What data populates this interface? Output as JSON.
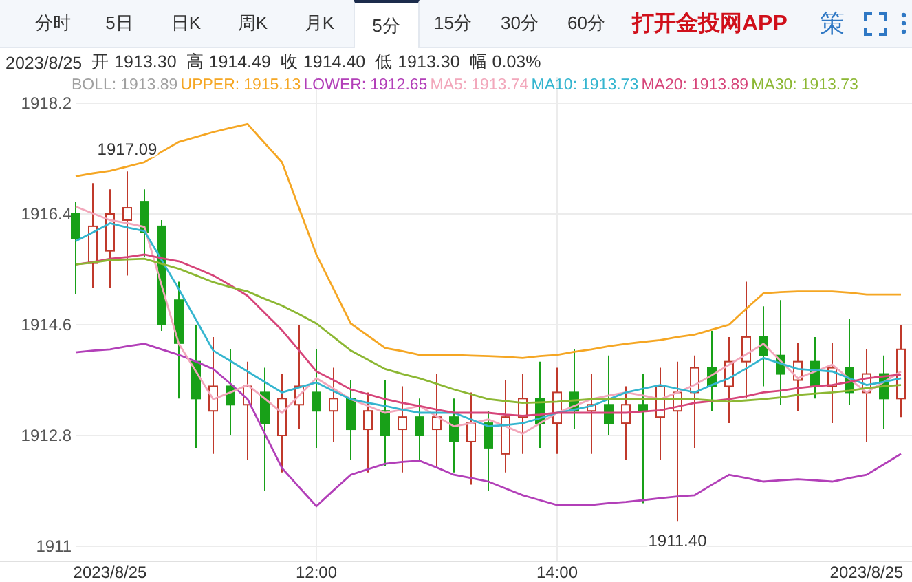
{
  "tabs": [
    {
      "label": "分时",
      "selected": false
    },
    {
      "label": "5日",
      "selected": false
    },
    {
      "label": "日K",
      "selected": false
    },
    {
      "label": "周K",
      "selected": false
    },
    {
      "label": "月K",
      "selected": false
    },
    {
      "label": "5分",
      "selected": true
    },
    {
      "label": "15分",
      "selected": false
    },
    {
      "label": "30分",
      "selected": false
    },
    {
      "label": "60分",
      "selected": false
    }
  ],
  "app_link": "打开金投网APP",
  "strategy_button": "策",
  "quote": {
    "date": "2023/8/25",
    "stats": [
      {
        "label": "开",
        "value": "1913.30"
      },
      {
        "label": "高",
        "value": "1914.49"
      },
      {
        "label": "收",
        "value": "1914.40"
      },
      {
        "label": "低",
        "value": "1913.30"
      },
      {
        "label": "幅",
        "value": "0.03%"
      }
    ]
  },
  "legend": [
    {
      "label": "BOLL:",
      "value": "1913.89",
      "color": "#a0a0a0"
    },
    {
      "value": "1915.13"
    },
    {
      "value": "1912.65"
    },
    {
      "value": "1913.74"
    },
    {
      "value": "1913.73"
    },
    {
      "value": "1913.89"
    },
    {
      "value": "1913.73"
    }
  ],
  "chart_data": {
    "type": "candlestick",
    "ylim": [
      1911,
      1918.2
    ],
    "yticks": [
      {
        "value": 1918.2,
        "label": "1918.2"
      },
      {
        "value": 1916.4,
        "label": "1916.4"
      },
      {
        "value": 1914.6,
        "label": "1914.6"
      },
      {
        "value": 1912.8,
        "label": "1912.8"
      },
      {
        "value": 1911,
        "label": "1911"
      }
    ],
    "grid": true,
    "categories": [
      null,
      null,
      "2023/8/25",
      null,
      null,
      null,
      null,
      null,
      null,
      null,
      null,
      null,
      null,
      null,
      "12:00",
      null,
      null,
      null,
      null,
      null,
      null,
      null,
      null,
      null,
      null,
      null,
      null,
      null,
      "14:00",
      null,
      null,
      null,
      null,
      null,
      null,
      null,
      null,
      null,
      null,
      null,
      null,
      null,
      null,
      null,
      null,
      null,
      "2023/8/25",
      null,
      null
    ],
    "ohlc": [
      [
        1916.4,
        1916.6,
        1915.1,
        1916.0
      ],
      [
        1915.6,
        1916.9,
        1915.2,
        1916.2
      ],
      [
        1915.8,
        1916.8,
        1915.2,
        1916.4
      ],
      [
        1916.3,
        1917.09,
        1915.4,
        1916.5
      ],
      [
        1916.6,
        1916.8,
        1915.7,
        1916.1
      ],
      [
        1916.2,
        1916.3,
        1914.5,
        1914.6
      ],
      [
        1915.0,
        1915.3,
        1913.4,
        1914.3
      ],
      [
        1914.0,
        1914.6,
        1912.6,
        1913.4
      ],
      [
        1913.2,
        1914.4,
        1912.5,
        1913.6
      ],
      [
        1913.6,
        1914.2,
        1912.8,
        1913.3
      ],
      [
        1913.3,
        1914.0,
        1912.4,
        1913.6
      ],
      [
        1913.5,
        1913.9,
        1911.9,
        1913.0
      ],
      [
        1912.8,
        1913.8,
        1912.2,
        1913.4
      ],
      [
        1913.3,
        1914.6,
        1912.9,
        1913.6
      ],
      [
        1913.5,
        1914.2,
        1912.6,
        1913.2
      ],
      [
        1913.2,
        1913.9,
        1912.7,
        1913.4
      ],
      [
        1913.4,
        1913.7,
        1912.4,
        1912.9
      ],
      [
        1912.9,
        1913.5,
        1912.2,
        1913.2
      ],
      [
        1913.2,
        1913.7,
        1912.3,
        1912.8
      ],
      [
        1912.9,
        1913.6,
        1912.2,
        1913.1
      ],
      [
        1913.1,
        1913.4,
        1912.4,
        1912.8
      ],
      [
        1912.9,
        1913.8,
        1912.3,
        1913.1
      ],
      [
        1913.1,
        1913.4,
        1912.2,
        1912.7
      ],
      [
        1912.7,
        1913.5,
        1912.0,
        1913.0
      ],
      [
        1913.0,
        1913.2,
        1911.9,
        1912.6
      ],
      [
        1912.5,
        1913.7,
        1912.2,
        1913.1
      ],
      [
        1913.1,
        1913.8,
        1912.5,
        1913.4
      ],
      [
        1913.4,
        1914.0,
        1912.6,
        1913.0
      ],
      [
        1913.0,
        1913.9,
        1912.5,
        1913.5
      ],
      [
        1913.5,
        1914.2,
        1912.9,
        1913.2
      ],
      [
        1913.2,
        1913.8,
        1912.5,
        1913.3
      ],
      [
        1913.3,
        1914.1,
        1912.8,
        1913.0
      ],
      [
        1913.0,
        1913.6,
        1912.4,
        1913.3
      ],
      [
        1913.3,
        1913.8,
        1911.7,
        1913.2
      ],
      [
        1913.1,
        1913.9,
        1912.4,
        1913.6
      ],
      [
        1913.2,
        1914.0,
        1911.4,
        1913.5
      ],
      [
        1913.5,
        1914.1,
        1912.6,
        1913.9
      ],
      [
        1913.9,
        1914.5,
        1913.2,
        1913.6
      ],
      [
        1913.6,
        1914.4,
        1913.0,
        1914.0
      ],
      [
        1914.0,
        1915.3,
        1913.4,
        1914.4
      ],
      [
        1914.4,
        1914.9,
        1913.6,
        1914.1
      ],
      [
        1914.1,
        1915.0,
        1913.3,
        1913.8
      ],
      [
        1913.7,
        1914.3,
        1913.2,
        1914.0
      ],
      [
        1914.0,
        1914.4,
        1913.4,
        1913.6
      ],
      [
        1913.6,
        1914.3,
        1913.0,
        1913.9
      ],
      [
        1913.9,
        1914.7,
        1913.3,
        1913.5
      ],
      [
        1913.5,
        1914.2,
        1912.7,
        1913.8
      ],
      [
        1913.8,
        1914.1,
        1912.9,
        1913.4
      ],
      [
        1913.4,
        1914.6,
        1913.1,
        1914.2
      ]
    ],
    "series": [
      {
        "name": "UPPER:",
        "type": "line",
        "color": "#f5a623",
        "values": [
          1917.01,
          1917.06,
          1917.1,
          1917.17,
          1917.24,
          1917.41,
          1917.57,
          1917.65,
          1917.73,
          1917.8,
          1917.86,
          1917.55,
          1917.24,
          1916.49,
          1915.74,
          1915.18,
          1914.62,
          1914.42,
          1914.22,
          1914.17,
          1914.11,
          1914.11,
          1914.11,
          1914.1,
          1914.09,
          1914.08,
          1914.06,
          1914.09,
          1914.11,
          1914.16,
          1914.2,
          1914.25,
          1914.29,
          1914.32,
          1914.35,
          1914.4,
          1914.44,
          1914.52,
          1914.6,
          1914.86,
          1915.11,
          1915.13,
          1915.14,
          1915.14,
          1915.14,
          1915.12,
          1915.09,
          1915.09,
          1915.09
        ]
      },
      {
        "name": "LOWER:",
        "type": "line",
        "color": "#b23fb8",
        "values": [
          1914.15,
          1914.18,
          1914.2,
          1914.25,
          1914.29,
          1914.2,
          1914.11,
          1914.0,
          1913.88,
          1913.64,
          1913.39,
          1912.83,
          1912.27,
          1911.96,
          1911.65,
          1911.91,
          1912.16,
          1912.25,
          1912.34,
          1912.37,
          1912.39,
          1912.28,
          1912.16,
          1912.11,
          1912.05,
          1911.94,
          1911.83,
          1911.75,
          1911.67,
          1911.67,
          1911.67,
          1911.7,
          1911.72,
          1911.75,
          1911.78,
          1911.81,
          1911.83,
          1912.0,
          1912.16,
          1912.11,
          1912.05,
          1912.07,
          1912.09,
          1912.07,
          1912.05,
          1912.11,
          1912.16,
          1912.33,
          1912.5
        ]
      },
      {
        "name": "MA5:",
        "type": "line",
        "color": "#f2a7bb",
        "values": [
          1916.52,
          1916.41,
          1916.3,
          1916.25,
          1916.19,
          1915.24,
          1914.29,
          1913.84,
          1913.39,
          1913.5,
          1913.62,
          1913.4,
          1913.17,
          1913.45,
          1913.73,
          1913.56,
          1913.39,
          1913.28,
          1913.17,
          1913.22,
          1913.28,
          1913.11,
          1912.95,
          1913.0,
          1913.06,
          1912.95,
          1912.83,
          1913.0,
          1913.17,
          1913.28,
          1913.39,
          1913.45,
          1913.5,
          1913.45,
          1913.39,
          1913.5,
          1913.62,
          1913.78,
          1913.95,
          1914.12,
          1914.29,
          1914.01,
          1913.73,
          1913.84,
          1913.95,
          1913.72,
          1913.5,
          1913.67,
          1913.84
        ]
      },
      {
        "name": "MA10:",
        "type": "line",
        "color": "#34b5cf",
        "values": [
          1915.96,
          1916.1,
          1916.25,
          1916.18,
          1916.12,
          1915.65,
          1915.18,
          1914.68,
          1914.18,
          1914.01,
          1913.84,
          1913.67,
          1913.5,
          1913.58,
          1913.66,
          1913.52,
          1913.39,
          1913.33,
          1913.28,
          1913.22,
          1913.17,
          1913.17,
          1913.17,
          1913.06,
          1912.95,
          1912.97,
          1913.0,
          1913.08,
          1913.17,
          1913.22,
          1913.28,
          1913.39,
          1913.5,
          1913.56,
          1913.62,
          1913.56,
          1913.5,
          1913.62,
          1913.73,
          1913.89,
          1914.06,
          1913.97,
          1913.88,
          1913.86,
          1913.84,
          1913.73,
          1913.62,
          1913.67,
          1913.73
        ]
      },
      {
        "name": "MA20:",
        "type": "line",
        "color": "#d64479",
        "values": [
          1915.58,
          1915.62,
          1915.67,
          1915.7,
          1915.74,
          1915.68,
          1915.63,
          1915.52,
          1915.4,
          1915.24,
          1915.07,
          1914.79,
          1914.51,
          1914.18,
          1913.84,
          1913.7,
          1913.55,
          1913.47,
          1913.39,
          1913.33,
          1913.28,
          1913.22,
          1913.17,
          1913.17,
          1913.17,
          1913.14,
          1913.12,
          1913.14,
          1913.17,
          1913.17,
          1913.17,
          1913.17,
          1913.17,
          1913.19,
          1913.21,
          1913.27,
          1913.33,
          1913.36,
          1913.39,
          1913.44,
          1913.5,
          1913.53,
          1913.57,
          1913.6,
          1913.62,
          1913.67,
          1913.73,
          1913.76,
          1913.79
        ]
      },
      {
        "name": "MA30:",
        "type": "line",
        "color": "#8cb733",
        "values": [
          1915.58,
          1915.61,
          1915.65,
          1915.66,
          1915.67,
          1915.59,
          1915.51,
          1915.4,
          1915.29,
          1915.21,
          1915.14,
          1915.02,
          1914.91,
          1914.77,
          1914.62,
          1914.4,
          1914.18,
          1914.03,
          1913.88,
          1913.8,
          1913.73,
          1913.64,
          1913.55,
          1913.47,
          1913.39,
          1913.36,
          1913.33,
          1913.34,
          1913.35,
          1913.37,
          1913.39,
          1913.39,
          1913.39,
          1913.39,
          1913.39,
          1913.39,
          1913.39,
          1913.37,
          1913.35,
          1913.37,
          1913.39,
          1913.42,
          1913.46,
          1913.48,
          1913.5,
          1913.53,
          1913.57,
          1913.6,
          1913.62
        ]
      }
    ],
    "annotations": [
      "1917.09",
      "1911.40"
    ]
  }
}
